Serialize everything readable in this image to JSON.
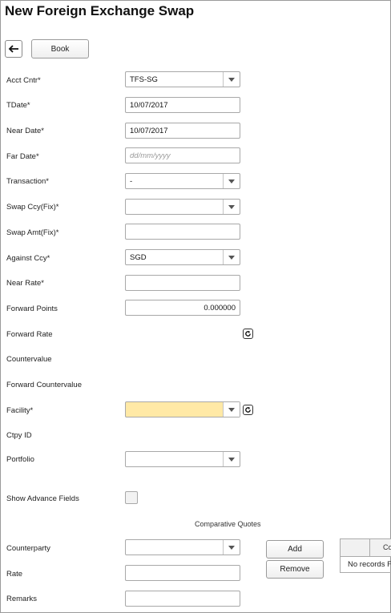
{
  "page": {
    "title": "New Foreign Exchange Swap"
  },
  "toolbar": {
    "back_icon": "arrow-left-icon",
    "book_label": "Book"
  },
  "form": {
    "acct_cntr": {
      "label": "Acct Cntr*",
      "value": "TFS-SG"
    },
    "tdate": {
      "label": "TDate*",
      "value": "10/07/2017"
    },
    "near_date": {
      "label": "Near Date*",
      "value": "10/07/2017"
    },
    "far_date": {
      "label": "Far Date*",
      "value": "",
      "placeholder": "dd/mm/yyyy"
    },
    "transaction": {
      "label": "Transaction*",
      "value": "-"
    },
    "swap_ccy": {
      "label": "Swap Ccy(Fix)*",
      "value": ""
    },
    "swap_amt": {
      "label": "Swap Amt(Fix)*",
      "value": ""
    },
    "against_ccy": {
      "label": "Against Ccy*",
      "value": "SGD"
    },
    "near_rate": {
      "label": "Near Rate*",
      "value": ""
    },
    "forward_points": {
      "label": "Forward Points",
      "value": "0.000000"
    },
    "forward_rate": {
      "label": "Forward Rate"
    },
    "countervalue": {
      "label": "Countervalue"
    },
    "forward_countervalue": {
      "label": "Forward Countervalue"
    },
    "facility": {
      "label": "Facility*",
      "value": ""
    },
    "ctpy_id": {
      "label": "Ctpy ID"
    },
    "portfolio": {
      "label": "Portfolio",
      "value": ""
    },
    "show_advance": {
      "label": "Show Advance Fields",
      "checked": false
    }
  },
  "quotes": {
    "title": "Comparative Quotes",
    "counterparty": {
      "label": "Counterparty",
      "value": ""
    },
    "rate": {
      "label": "Rate",
      "value": ""
    },
    "remarks": {
      "label": "Remarks",
      "value": ""
    },
    "add_label": "Add",
    "remove_label": "Remove",
    "grid": {
      "column_partial": "Co",
      "empty_text": "No records F"
    }
  },
  "colors": {
    "facility_bg": "#ffe9a6"
  }
}
